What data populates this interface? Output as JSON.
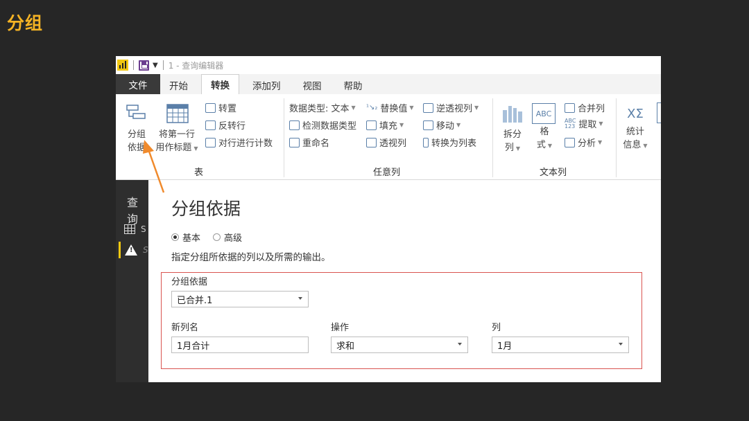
{
  "slide_title": "分组",
  "window": {
    "title": "1 - 查询编辑器"
  },
  "tabs": [
    {
      "label": "文件"
    },
    {
      "label": "开始"
    },
    {
      "label": "转换"
    },
    {
      "label": "添加列"
    },
    {
      "label": "视图"
    },
    {
      "label": "帮助"
    }
  ],
  "ribbon": {
    "table_group": {
      "label": "表",
      "group_by": [
        "分组",
        "依据"
      ],
      "use_first_row": [
        "将第一行",
        "用作标题"
      ],
      "transpose": "转置",
      "reverse_rows": "反转行",
      "count_rows": "对行进行计数"
    },
    "any_column_group": {
      "label": "任意列",
      "data_type": "数据类型: 文本",
      "detect_type": "检测数据类型",
      "rename": "重命名",
      "replace_values": "替换值",
      "fill": "填充",
      "pivot": "透视列",
      "unpivot": "逆透视列",
      "move": "移动",
      "to_list": "转换为列表"
    },
    "text_column_group": {
      "label": "文本列",
      "split": [
        "拆分",
        "列"
      ],
      "format": [
        "格",
        "式"
      ],
      "merge": "合并列",
      "extract": "提取",
      "parse": "分析",
      "abc": "ABC",
      "abc123_top": "ABC",
      "abc123_bottom": "123"
    },
    "number_group": {
      "stats": [
        "统计",
        "信息"
      ],
      "sigma_icon": "XΣ"
    }
  },
  "query_pane": {
    "title": "查询",
    "items": [
      {
        "label": "S"
      },
      {
        "label": "S"
      }
    ]
  },
  "dialog": {
    "title": "分组依据",
    "radio_basic": "基本",
    "radio_advanced": "高级",
    "description": "指定分组所依据的列以及所需的输出。",
    "group_by_label": "分组依据",
    "group_by_value": "已合并.1",
    "new_col_label": "新列名",
    "new_col_value": "1月合计",
    "op_label": "操作",
    "op_value": "求和",
    "col_label": "列",
    "col_value": "1月"
  },
  "colors": {
    "accent": "#f5b324",
    "slide_bg": "#262626",
    "highlight_box": "#d9534f",
    "arrow": "#f08a2c"
  }
}
